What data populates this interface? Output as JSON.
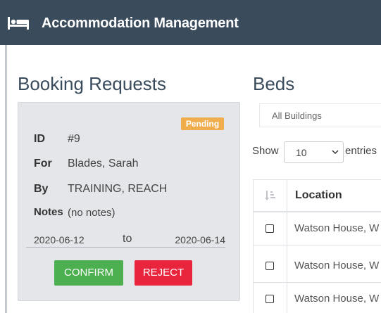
{
  "header": {
    "title": "Accommodation Management",
    "icon": "bed-icon"
  },
  "booking": {
    "heading": "Booking Requests",
    "status": "Pending",
    "id_label": "ID",
    "id_value": "#9",
    "for_label": "For",
    "for_value": "Blades, Sarah",
    "by_label": "By",
    "by_value": "TRAINING, REACH",
    "notes_label": "Notes",
    "notes_value": "(no notes)",
    "date_from": "2020-06-12",
    "date_sep": "to",
    "date_to": "2020-06-14",
    "confirm_label": "CONFIRM",
    "reject_label": "REJECT"
  },
  "beds": {
    "heading": "Beds",
    "building_select": "All Buildings",
    "show_label": "Show",
    "entries_value": "10",
    "entries_label": "entries",
    "columns": [
      "Location"
    ],
    "rows": [
      {
        "location": "Watson House, W"
      },
      {
        "location": "Watson House, W"
      },
      {
        "location": "Watson House, W"
      }
    ]
  },
  "colors": {
    "header_bg": "#3a4b5c",
    "pending": "#f0ad4e",
    "confirm": "#4caf50",
    "reject": "#e8253d"
  }
}
